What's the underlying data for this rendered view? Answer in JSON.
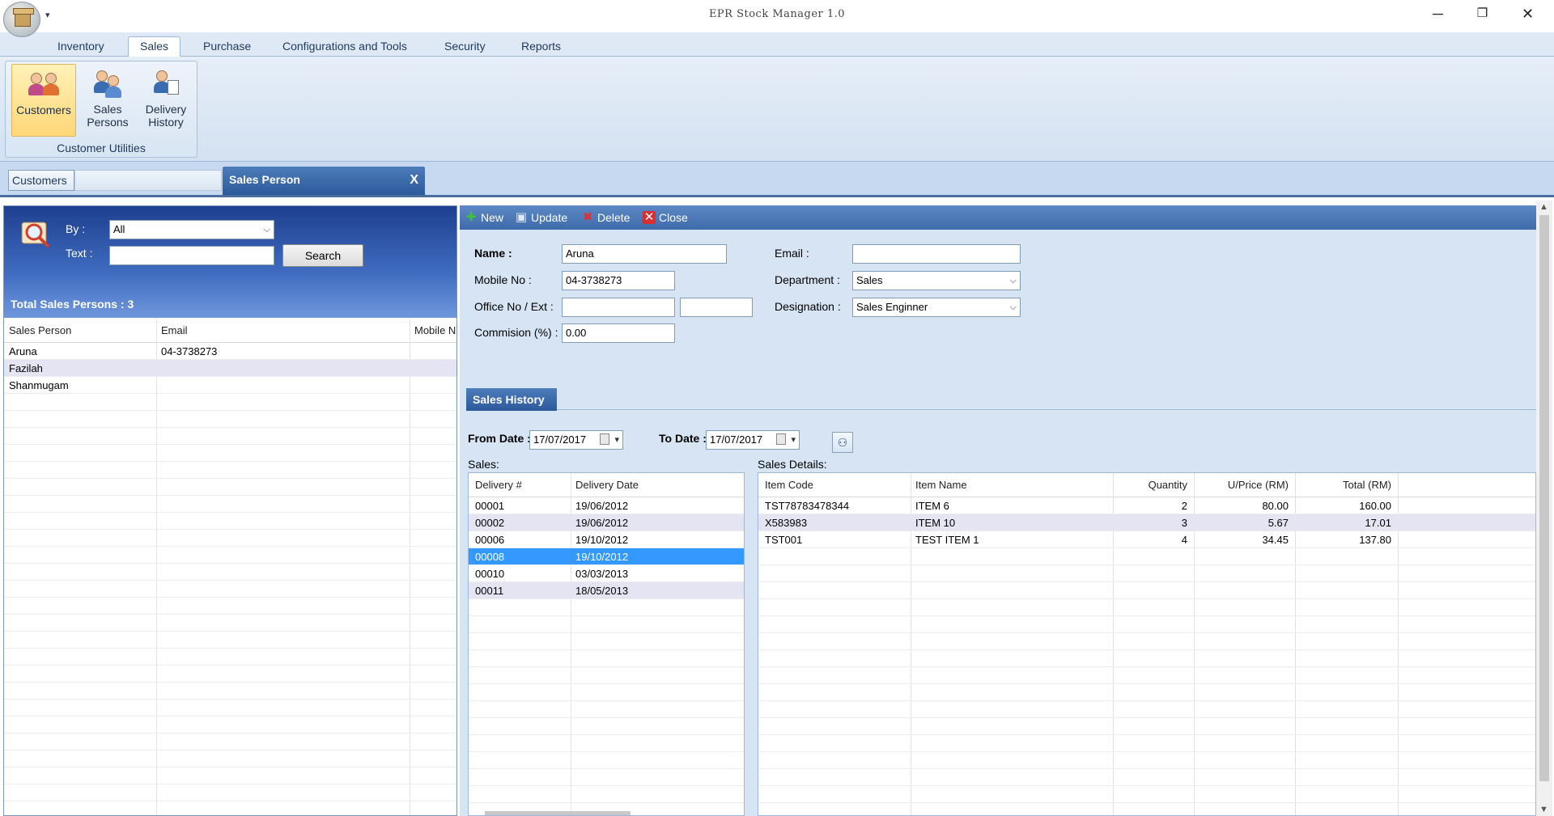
{
  "window": {
    "title": "EPR Stock Manager 1.0",
    "minimize_glyph": "─",
    "restore_glyph": "❐",
    "close_glyph": "✕",
    "qat_glyph": "▾"
  },
  "ribbon": {
    "tabs": [
      "Inventory",
      "Sales",
      "Purchase",
      "Configurations and Tools",
      "Security",
      "Reports"
    ],
    "active_tab": "Sales",
    "group_label": "Customer Utilities",
    "buttons": [
      {
        "line1": "Customers",
        "line2": "",
        "icon": "customers-icon"
      },
      {
        "line1": "Sales",
        "line2": "Persons",
        "icon": "sales-persons-icon"
      },
      {
        "line1": "Delivery",
        "line2": "History",
        "icon": "delivery-history-icon"
      }
    ]
  },
  "doc_tabs": {
    "customers": "Customers",
    "sales_person": "Sales Person",
    "close_glyph": "X"
  },
  "search": {
    "by_label": "By :",
    "by_value": "All",
    "text_label": "Text :",
    "text_value": "",
    "button": "Search",
    "total": "Total Sales Persons : 3"
  },
  "persons_grid": {
    "columns": [
      "Sales Person",
      "Email",
      "Mobile N"
    ],
    "rows": [
      [
        "Aruna",
        "04-3738273",
        ""
      ],
      [
        "Fazilah",
        "",
        ""
      ],
      [
        "Shanmugam",
        "",
        ""
      ]
    ]
  },
  "toolbar": {
    "new": "New",
    "update": "Update",
    "delete": "Delete",
    "close": "Close"
  },
  "form": {
    "name_label": "Name :",
    "name_value": "Aruna",
    "mobile_label": "Mobile No :",
    "mobile_value": "04-3738273",
    "office_label": "Office No / Ext :",
    "office_value": "",
    "ext_value": "",
    "commision_label": "Commision (%) :",
    "commision_value": "0.00",
    "email_label": "Email :",
    "email_value": "",
    "department_label": "Department :",
    "department_value": "Sales",
    "designation_label": "Designation :",
    "designation_value": "Sales Enginner"
  },
  "sales_history": {
    "tab": "Sales History",
    "from_label": "From Date :",
    "from_value": "17/07/2017",
    "to_label": "To Date :",
    "to_value": "17/07/2017",
    "sales_label": "Sales:",
    "details_label": "Sales Details:",
    "sales_columns": [
      "Delivery #",
      "Delivery Date"
    ],
    "sales_rows": [
      [
        "00001",
        "19/06/2012"
      ],
      [
        "00002",
        "19/06/2012"
      ],
      [
        "00006",
        "19/10/2012"
      ],
      [
        "00008",
        "19/10/2012"
      ],
      [
        "00010",
        "03/03/2013"
      ],
      [
        "00011",
        "18/05/2013"
      ]
    ],
    "selected_sale_index": 3,
    "details_columns": [
      "Item Code",
      "Item Name",
      "Quantity",
      "U/Price (RM)",
      "Total (RM)"
    ],
    "details_rows": [
      [
        "TST78783478344",
        "ITEM 6",
        "2",
        "80.00",
        "160.00"
      ],
      [
        "X583983",
        "ITEM 10",
        "3",
        "5.67",
        "17.01"
      ],
      [
        "TST001",
        "TEST ITEM 1",
        "4",
        "34.45",
        "137.80"
      ]
    ]
  }
}
